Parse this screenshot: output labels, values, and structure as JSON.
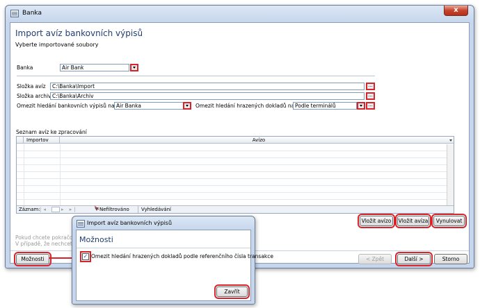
{
  "window": {
    "title": "Banka",
    "close_glyph": "x"
  },
  "header": {
    "title": "Import avíz bankovních výpisů",
    "subtitle": "Vyberte importované soubory"
  },
  "form": {
    "bank_label": "Banka",
    "bank_value": "Air Bank",
    "folder_aviz_label": "Složka avíz",
    "folder_aviz_value": "C:\\Banka\\Import",
    "folder_archive_label": "Složka archiv",
    "folder_archive_value": "C:\\Banka\\Archiv",
    "restrict_statements_label": "Omezit hledání bankovních výpisů na knihu",
    "restrict_statements_value": "Air Banka",
    "restrict_docs_label": "Omezit hledání hrazených dokladů na knihy",
    "restrict_docs_value": "Podle terminálů",
    "browse_glyph": "..."
  },
  "grid": {
    "label": "Seznam avíz ke zpracování",
    "col_import": "Importov",
    "col_aviz": "Avízo",
    "nav_label": "Záznam:",
    "nav_prev": "|◂ ◂",
    "nav_next": "▸ ▸|",
    "filter_label": "Nefiltrováno",
    "search_label": "Vyhledávání"
  },
  "buttons": {
    "insert_aviz": "Vložit avízo",
    "insert_avizos": "Vložit avíza",
    "clear": "Vynulovat",
    "options": "Možnosti",
    "back": "< Zpět",
    "next": "Další >",
    "cancel": "Storno"
  },
  "hints": {
    "line1": "Pokud chcete pokračov",
    "line2": "V případě, že nechcete"
  },
  "dialog": {
    "title": "Import avíz bankovních výpisů",
    "heading": "Možnosti",
    "checkbox_label": "Omezit hledání hrazených dokladů podle referenčního čísla transakce",
    "checkbox_checked": true,
    "check_glyph": "✓",
    "close_button": "Zavřít"
  },
  "colors": {
    "highlight": "#d8232a",
    "heading": "#1f3d73"
  }
}
